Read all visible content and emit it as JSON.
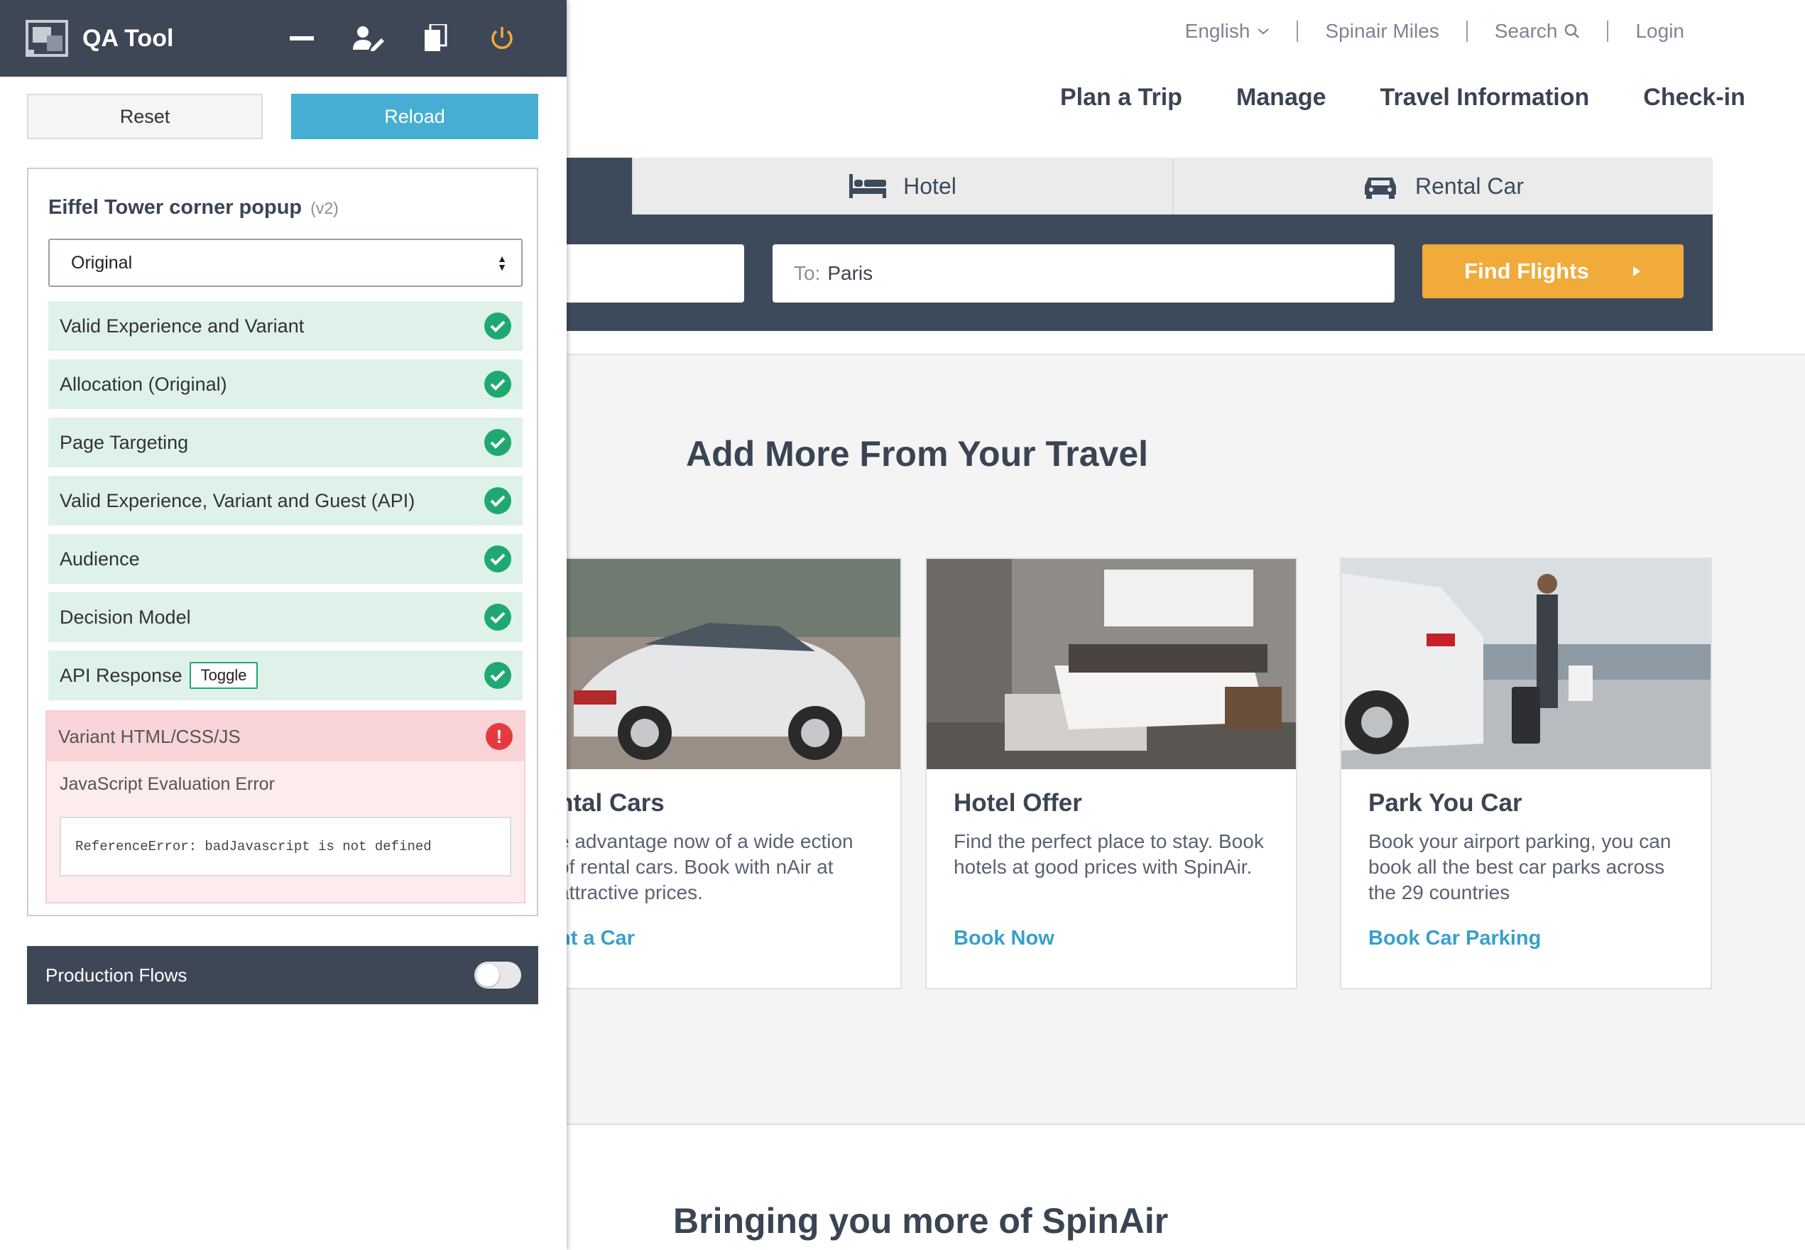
{
  "qa_panel": {
    "title": "QA Tool",
    "reset_label": "Reset",
    "reload_label": "Reload",
    "experience_name": "Eiffel Tower corner popup",
    "experience_version": "(v2)",
    "variant_select": "Original",
    "checks": [
      {
        "label": "Valid Experience and Variant",
        "status": "pass"
      },
      {
        "label": "Allocation (Original)",
        "status": "pass"
      },
      {
        "label": "Page Targeting",
        "status": "pass"
      },
      {
        "label": "Valid Experience, Variant and Guest (API)",
        "status": "pass"
      },
      {
        "label": "Audience",
        "status": "pass"
      },
      {
        "label": "Decision Model",
        "status": "pass"
      },
      {
        "label": "API Response",
        "status": "pass",
        "toggle_label": "Toggle"
      }
    ],
    "error": {
      "title": "Variant HTML/CSS/JS",
      "subtitle": "JavaScript Evaluation Error",
      "message": "ReferenceError: badJavascript is not defined",
      "icon": "!"
    },
    "production_flows": {
      "label": "Production Flows",
      "enabled": false
    },
    "colors": {
      "header": "#3d4756",
      "reload": "#46aed2",
      "pass": "#1fa971",
      "error": "#e43a3f",
      "power": "#f1ab3a"
    }
  },
  "site": {
    "topbar": {
      "language": "English",
      "miles": "Spinair Miles",
      "search": "Search",
      "login": "Login"
    },
    "nav": [
      "Plan a Trip",
      "Manage",
      "Travel Information",
      "Check-in"
    ],
    "tabs": {
      "hotel": "Hotel",
      "rental_car": "Rental Car"
    },
    "search": {
      "to_label": "To:",
      "to_value": "Paris",
      "find_button": "Find Flights"
    },
    "section_title": "Add More From Your Travel",
    "cards": [
      {
        "title": "ntal Cars",
        "text": "e advantage now of a wide ection of rental cars. Book with nAir at attractive prices.",
        "link": "nt a Car"
      },
      {
        "title": "Hotel Offer",
        "text": "Find the perfect place to stay. Book hotels at good prices with SpinAir.",
        "link": "Book Now"
      },
      {
        "title": "Park You Car",
        "text": "Book your airport parking, you can book all the best car parks across the 29 countries",
        "link": "Book Car Parking"
      }
    ],
    "bottom_title": "Bringing you more of SpinAir",
    "colors": {
      "dark": "#3d4a5c",
      "accent": "#f1ab3a",
      "link": "#3aa0c8"
    }
  }
}
